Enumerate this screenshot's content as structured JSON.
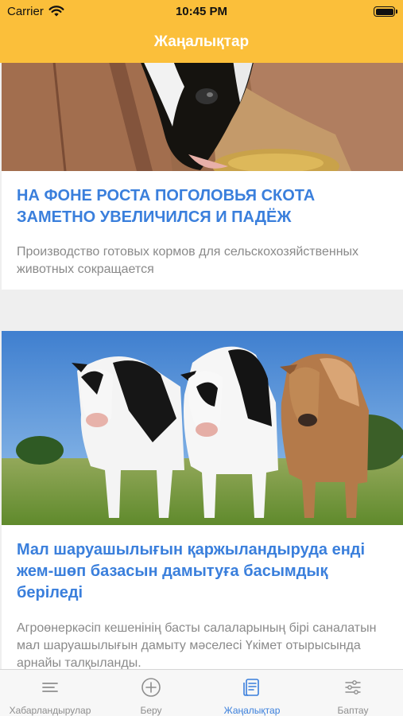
{
  "status_bar": {
    "carrier": "Carrier",
    "time": "10:45 PM"
  },
  "header": {
    "title": "Жаңалықтар"
  },
  "news": [
    {
      "title": "НА ФОНЕ РОСТА ПОГОЛОВЬЯ СКОТА ЗАМЕТНО УВЕЛИЧИЛСЯ И ПАДЁЖ",
      "description": "Производство готовых кормов для сельскохозяйственных животных сокращается"
    },
    {
      "title": "Мал шаруашылығын қаржыландыруда енді жем-шөп базасын дамытуға басымдық беріледі",
      "description": "Агроөнеркәсіп кешенінің басты салаларының бірі саналатын мал шаруашылығын дамыту мәселесі Үкімет отырысында арнайы талқыланды."
    }
  ],
  "tabs": [
    {
      "label": "Хабарландырулар",
      "icon": "list-icon",
      "active": false
    },
    {
      "label": "Беру",
      "icon": "plus-circle-icon",
      "active": false
    },
    {
      "label": "Жаңалықтар",
      "icon": "newspaper-icon",
      "active": true
    },
    {
      "label": "Баптау",
      "icon": "sliders-icon",
      "active": false
    }
  ],
  "colors": {
    "header": "#fbbf3a",
    "accent": "#3a7fdc",
    "text_muted": "#8a8a8a",
    "tab_inactive": "#8e8e8e"
  }
}
